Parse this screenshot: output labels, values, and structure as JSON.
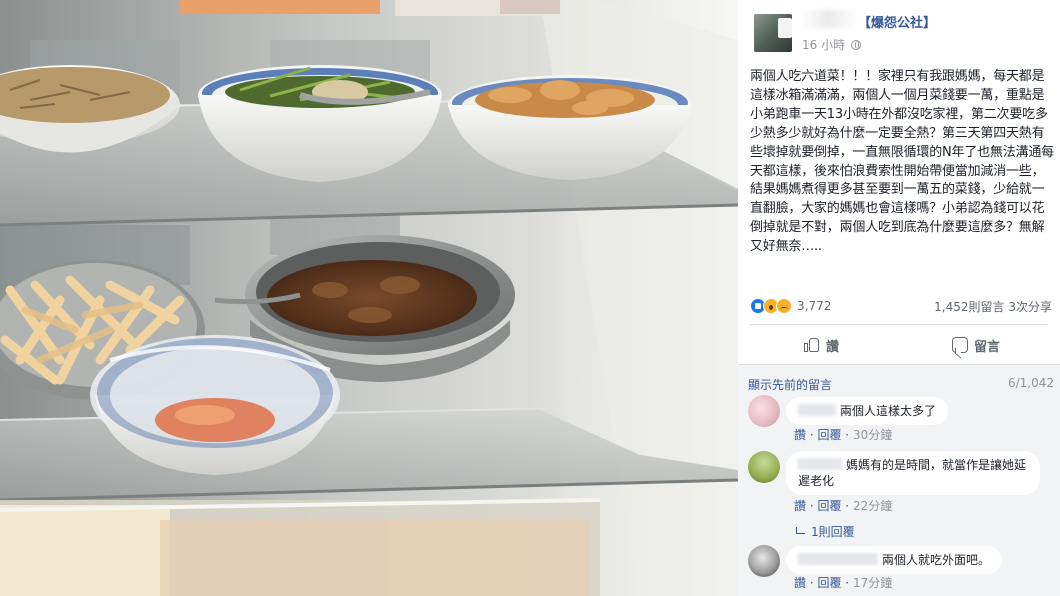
{
  "post": {
    "page_name": "【爆怨公社】",
    "time": "16 小時",
    "text": "兩個人吃六道菜！！！家裡只有我跟媽媽，每天都是這樣冰箱滿滿滿，兩個人一個月菜錢要一萬，重點是小弟跑車一天13小時在外都沒吃家裡，第二次要吃多少熱多少就好為什麼一定要全熱？第三天第四天熱有些壞掉就要倒掉，一直無限循環的N年了也無法溝通每天都這樣，後來怕浪費索性開始帶便當加減消一些，結果媽媽煮得更多甚至要到一萬五的菜錢，少給就一直翻臉，大家的媽媽也會這樣嗎？小弟認為錢可以花倒掉就是不對，兩個人吃到底為什麼要這麼多？無解又好無奈….."
  },
  "stats": {
    "reactions_count": "3,772",
    "comments_count": "1,452則留言",
    "shares_count": "3次分享"
  },
  "actions": {
    "like_label": "讚",
    "comment_label": "留言"
  },
  "comments_header": {
    "prev_link": "顯示先前的留言",
    "count": "6/1,042"
  },
  "comments": [
    {
      "text": "兩個人這樣太多了",
      "like": "讚",
      "reply": "回覆",
      "time": "30分鐘"
    },
    {
      "text": "媽媽有的是時間，就當作是讓她延遲老化",
      "like": "讚",
      "reply": "回覆",
      "time": "22分鐘",
      "replies_link": "1則回覆"
    },
    {
      "text": "兩個人就吃外面吧。",
      "like": "讚",
      "reply": "回覆",
      "time": "17分鐘"
    }
  ],
  "icons": [
    "globe-icon",
    "like-icon",
    "comment-icon",
    "reply-arrow-icon",
    "like-reaction-icon",
    "wow-reaction-icon",
    "sad-reaction-icon"
  ]
}
